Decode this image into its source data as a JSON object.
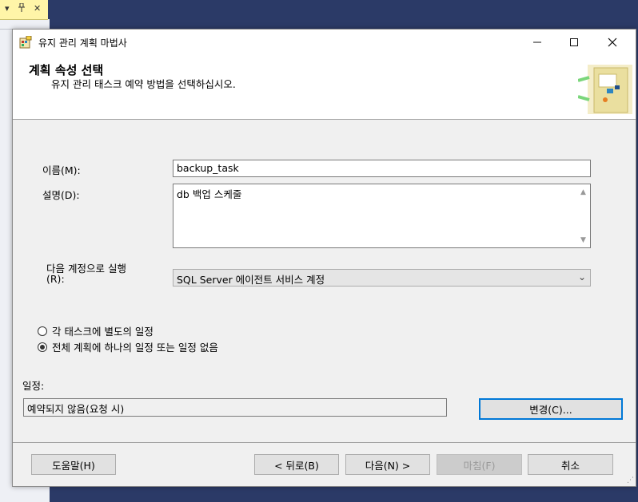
{
  "dialog": {
    "title": "유지 관리 계획 마법사",
    "header_title": "계획 속성 선택",
    "header_subtitle": "유지 관리 태스크 예약 방법을 선택하십시오."
  },
  "form": {
    "name_label": "이름(M):",
    "name_value": "backup_task",
    "description_label": "설명(D):",
    "description_value": "db 백업 스케줄",
    "run_as_label_line1": "다음 계정으로 실행",
    "run_as_label_line2": "(R):",
    "run_as_value": "SQL Server 에이전트 서비스 계정",
    "radio_separate": "각 태스크에 별도의 일정",
    "radio_single": "전체 계획에 하나의 일정 또는 일정 없음",
    "selected_radio": "single",
    "schedule_label": "일정:",
    "schedule_value": "예약되지 않음(요청 시)",
    "change_button": "변경(C)..."
  },
  "footer": {
    "help": "도움말(H)",
    "back": "< 뒤로(B)",
    "next": "다음(N) >",
    "finish": "마침(F)",
    "cancel": "취소"
  },
  "background": {
    "pane_glyph_1": "▾",
    "pane_glyph_2": "ᵖ",
    "pane_close": "✕"
  },
  "colors": {
    "ide_background": "#2b3a67",
    "pane_tab": "#fff5a8",
    "focus_blue": "#0078d7"
  }
}
